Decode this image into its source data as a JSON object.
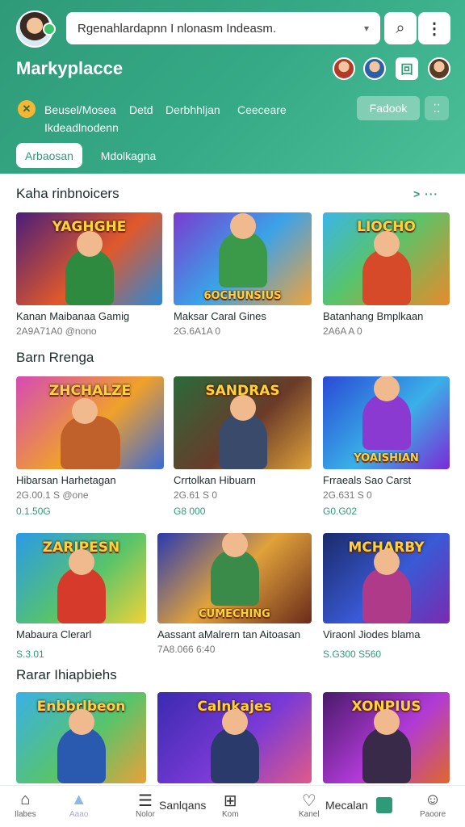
{
  "header": {
    "search_text": "Rgenahlardapnn I nlonasm Indeasm.",
    "title": "Markyplacce",
    "app_icon_glyph": "回",
    "feedback_label": "Fadook",
    "grid_glyph": "⁚⁚",
    "categories": [
      "Beusel/Mosea",
      "Detd",
      "Derbhhljan",
      "Ceeceare",
      "Ikdeadlnodenn"
    ],
    "tabs": [
      "Arbaosan",
      "Mdolkagna"
    ]
  },
  "sections": [
    {
      "title": "Kaha rinbnoicers",
      "see_all": "> ···",
      "items": [
        {
          "name": "Kanan Maibanaa Gamig",
          "meta": "2A9A71A0 @nono",
          "banner": "YAGHGHE"
        },
        {
          "name": "Maksar Caral Gines",
          "meta": "2G.6A1A 0",
          "banner": "6OCHUNSIUS"
        },
        {
          "name": "Batanhang Bmplkaan",
          "meta": "2A6A A 0",
          "banner": "LIOCHO"
        }
      ]
    },
    {
      "title": "Barn Rrenga",
      "items": [
        {
          "name": "Hibarsan Harhetagan",
          "meta": "2G.00.1 S @one",
          "price": "0.1.50G",
          "banner": "ZHCHALZE"
        },
        {
          "name": "Crrtolkan Hibuarn",
          "meta": "2G.61 S 0",
          "price": "G8 000",
          "banner": "SANDRAS"
        },
        {
          "name": "Frraeals Sao Carst",
          "meta": "2G.631 S 0",
          "price": "G0.G02",
          "banner": "YOAISHIAN"
        }
      ]
    },
    {
      "items": [
        {
          "name": "Mabaura Clerarl",
          "meta": "",
          "price": "S.3.01",
          "banner": "ZARIPESN"
        },
        {
          "name": "Aassant aMalrern tan Aitoasan",
          "meta": "7A8.066 6:40",
          "price": "",
          "banner": "CUMECHING"
        },
        {
          "name": "Viraonl Jiodes blama",
          "meta": "",
          "price": "S.G300 S560",
          "banner": "MCHARBY"
        }
      ]
    },
    {
      "title": "Rarar Ihiapbiehs",
      "items": [
        {
          "name": "",
          "banner": "Enbbrlbeon"
        },
        {
          "name": "",
          "banner": "Calnkajes"
        },
        {
          "name": "",
          "banner": "XONPIUS"
        }
      ]
    }
  ],
  "bottom_nav": {
    "home": "Ilabes",
    "explore": "Aaao",
    "savings_icon_label": "Nolor",
    "savings_text": "Sanlqans",
    "gift_label": "Kom",
    "messages_icon_label": "Kanel",
    "messages_text": "Mecalan",
    "profile_label": "Paoore"
  },
  "colors": {
    "accent": "#2f9a78",
    "header_gradient_start": "#2f9a78",
    "header_gradient_end": "#4bbf97"
  }
}
